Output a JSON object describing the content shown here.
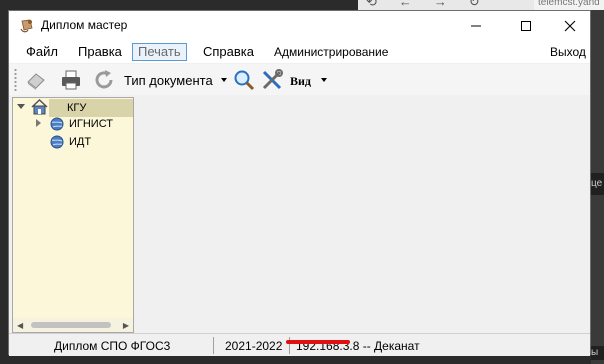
{
  "background": {
    "url_fragment": "telemcst.yand",
    "right_chip_text": "це",
    "right_chip2_text": "ы"
  },
  "window": {
    "title": "Диплом мастер",
    "controls": {
      "minimize": "—",
      "maximize": "☐",
      "close": "✕"
    }
  },
  "menu": {
    "file": "Файл",
    "edit": "Правка",
    "print": "Печать",
    "help": "Справка",
    "admin": "Администрирование",
    "exit": "Выход"
  },
  "toolbar": {
    "doc_type_label": "Тип документа",
    "view_label": "Вид"
  },
  "tree": {
    "root": "КГУ",
    "children": [
      "ИГНИСТ",
      "ИДТ"
    ]
  },
  "status": {
    "program": "Диплом СПО ФГОС3",
    "year": "2021-2022",
    "connection": "192.168.3.8 -- Деканат"
  },
  "colors": {
    "tree_bg": "#fbf7d8",
    "tree_selected": "#d8d3a8",
    "active_menu_border": "#5a9bd5",
    "status_underline": "#e01010"
  }
}
